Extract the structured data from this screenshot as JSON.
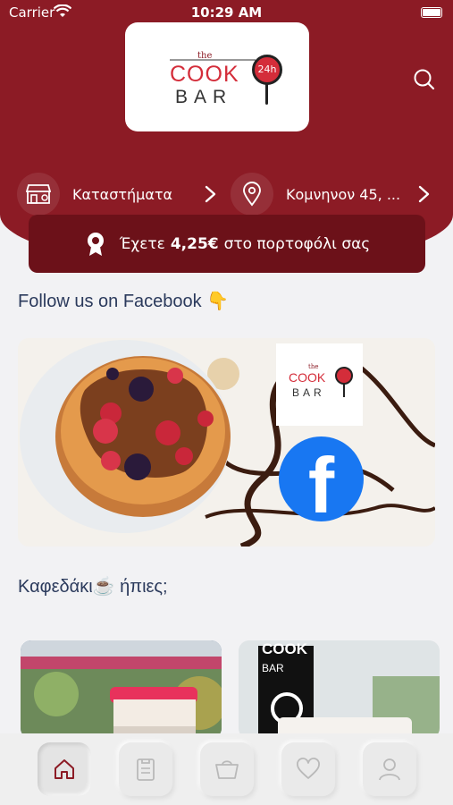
{
  "status_bar": {
    "carrier": "Carrier",
    "time": "10:29 AM"
  },
  "header": {
    "logo": {
      "the": "the",
      "cook": "COOK",
      "bar": "BAR",
      "badge": "24h"
    },
    "stores_label": "Καταστήματα",
    "address_label": "Kομνηνον 45, ..."
  },
  "wallet": {
    "prefix": "Έχετε",
    "amount": "4,25€",
    "suffix": "στο πορτοφόλι σας"
  },
  "facebook_section": {
    "title": "Follow us on Facebook 👇",
    "banner_logo_the": "the",
    "banner_logo_cook": "COOK",
    "banner_logo_bar": "BAR",
    "fb_letter": "f"
  },
  "coffee_section": {
    "title": "Καφεδάκι☕ ήπιες;",
    "card2_text_cook": "COOK",
    "card2_text_bar": "BAR"
  },
  "tabbar": {
    "items": [
      "home-icon",
      "menu-icon",
      "basket-icon",
      "heart-icon",
      "profile-icon"
    ],
    "active": "home-icon"
  },
  "colors": {
    "brand": "#8c1b25",
    "brand_dark": "#6c1119",
    "accent_red": "#d42d3a",
    "title_text": "#2b3a5c",
    "facebook": "#1877f2"
  }
}
